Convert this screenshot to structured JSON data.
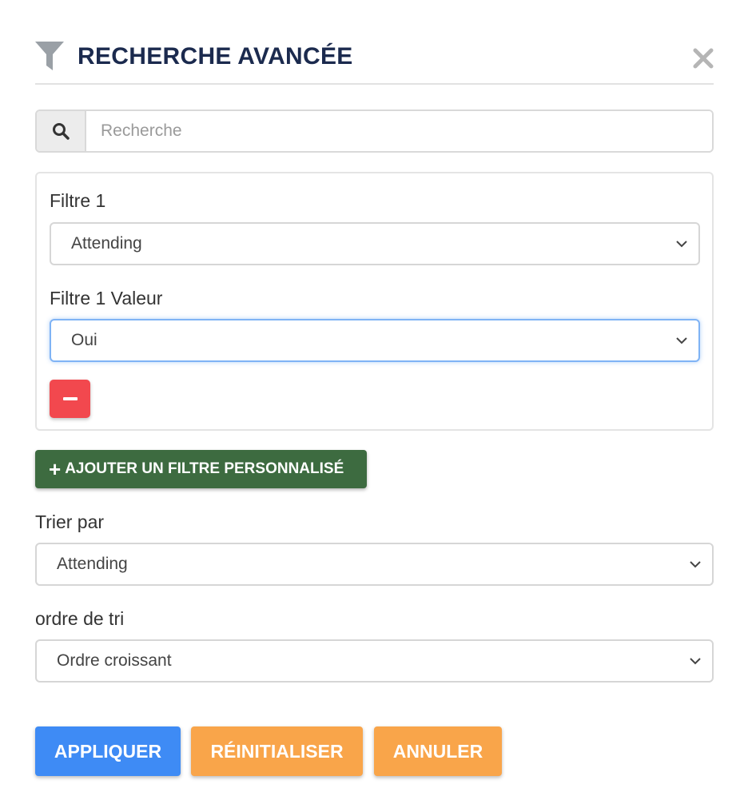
{
  "header": {
    "title": "RECHERCHE AVANCÉE",
    "icon": "filter-icon",
    "close_icon": "close-icon"
  },
  "search": {
    "icon": "search-icon",
    "placeholder": "Recherche",
    "value": ""
  },
  "filters": [
    {
      "label": "Filtre 1",
      "selected": "Attending",
      "value_label": "Filtre 1 Valeur",
      "value_selected": "Oui"
    }
  ],
  "add_filter_label": "AJOUTER UN FILTRE PERSONNALISÉ",
  "sort": {
    "label": "Trier par",
    "selected": "Attending"
  },
  "sort_order": {
    "label": "ordre de tri",
    "selected": "Ordre croissant"
  },
  "actions": {
    "apply": "APPLIQUER",
    "reset": "RÉINITIALISER",
    "cancel": "ANNULER"
  },
  "colors": {
    "title": "#1b2a4e",
    "apply": "#3e8bf5",
    "secondary": "#f9a54a",
    "add_filter": "#3d6b40",
    "remove": "#f2484e"
  }
}
